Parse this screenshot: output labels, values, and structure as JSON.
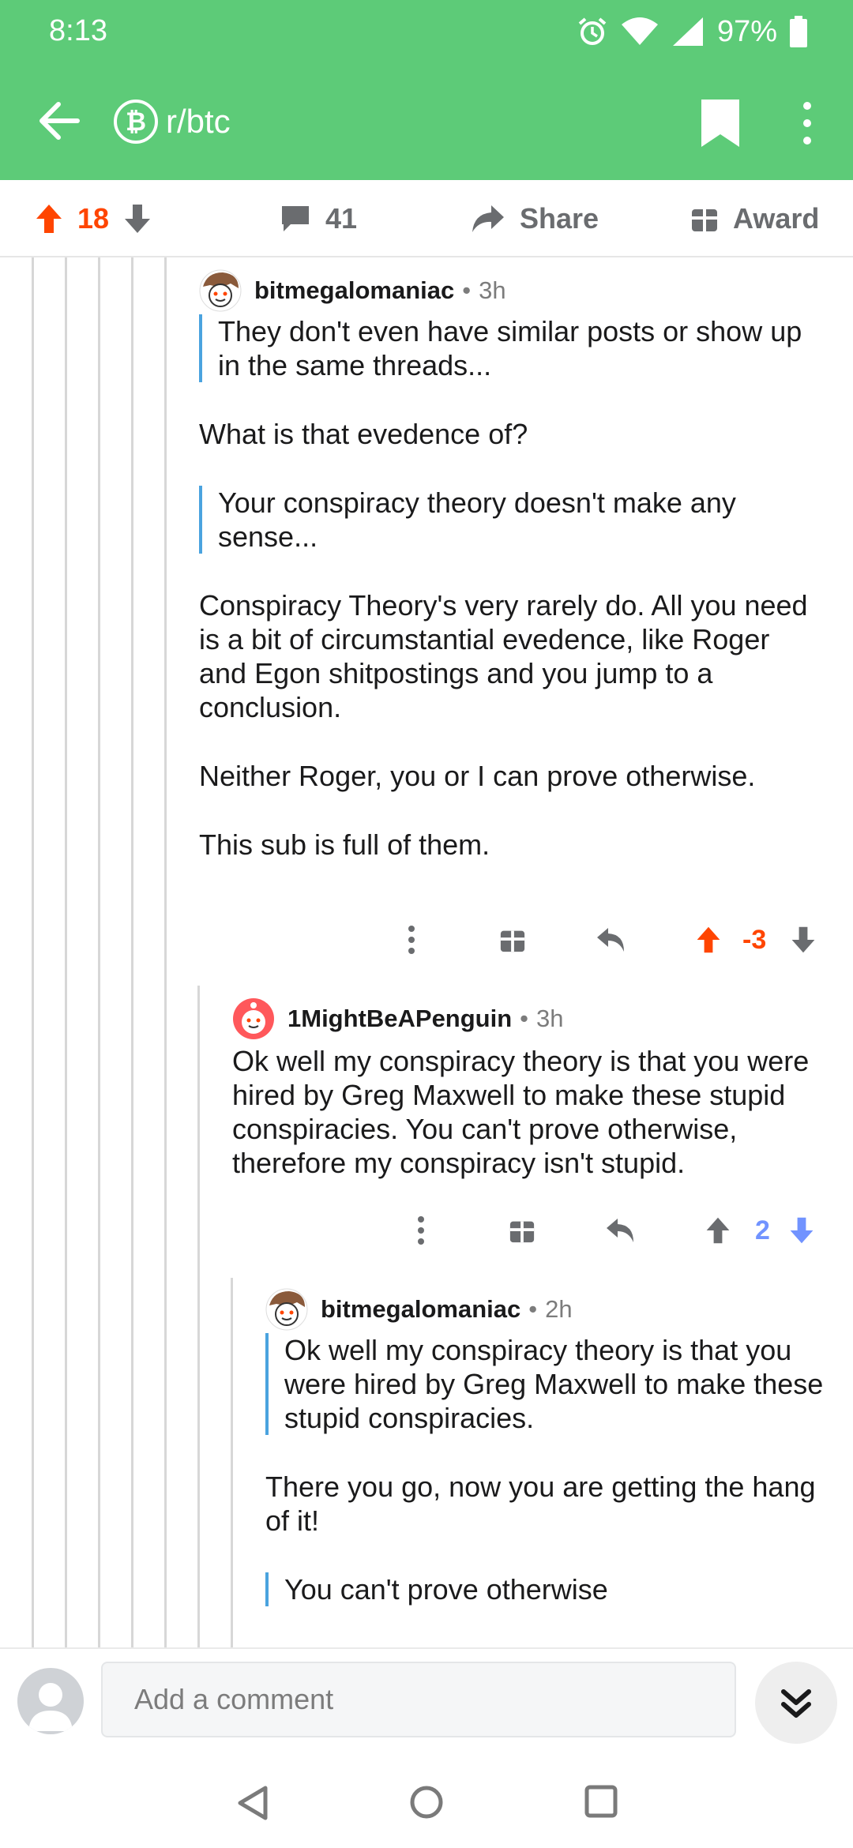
{
  "status_bar": {
    "time": "8:13",
    "battery": "97%"
  },
  "header": {
    "subreddit": "r/btc",
    "subreddit_icon": "bitcoin-icon",
    "theme_color": "#5dcb78"
  },
  "post_actions": {
    "score": "18",
    "comments": "41",
    "share_label": "Share",
    "award_label": "Award",
    "upvote_color": "#ff4500"
  },
  "comments": [
    {
      "author": "bitmegalomaniac",
      "time": "3h",
      "quote_1": "They don't even have similar posts or show up in the same threads...",
      "para_1": "What is that evedence of?",
      "quote_2": "Your conspiracy theory doesn't make any sense...",
      "para_2": "Conspiracy Theory's very rarely do.  All you need is a bit of circumstantial evedence, like Roger and Egon shitpostings and you jump to a conclusion.",
      "para_3": "Neither Roger, you or I can prove otherwise.",
      "para_4": "This sub is full of them.",
      "score": "-3",
      "vote_state": "upvoted"
    },
    {
      "author": "1MightBeAPenguin",
      "time": "3h",
      "para_1": "Ok well my conspiracy theory is that you were hired by Greg Maxwell to make these stupid conspiracies. You can't prove otherwise, therefore my conspiracy isn't stupid.",
      "score": "2",
      "vote_state": "downvoted"
    },
    {
      "author": "bitmegalomaniac",
      "time": "2h",
      "quote_1": "Ok well my conspiracy theory is that you were hired by Greg Maxwell to make these stupid conspiracies.",
      "para_1": "There you go, now you are getting the hang of it!",
      "quote_2": "You can't prove otherwise"
    }
  ],
  "comment_bar": {
    "placeholder": "Add a comment"
  },
  "colors": {
    "quote_bar": "#4aa3df",
    "downvote": "#7193ff"
  }
}
